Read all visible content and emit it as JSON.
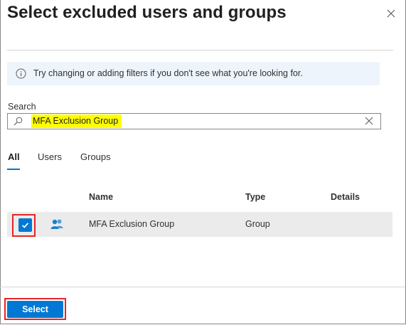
{
  "dialog": {
    "title": "Select excluded users and groups"
  },
  "info": {
    "message": "Try changing or adding filters if you don't see what you're looking for."
  },
  "search": {
    "label": "Search",
    "value": "MFA Exclusion Group"
  },
  "tabs": [
    {
      "label": "All",
      "active": true
    },
    {
      "label": "Users",
      "active": false
    },
    {
      "label": "Groups",
      "active": false
    }
  ],
  "table": {
    "columns": [
      "Name",
      "Type",
      "Details"
    ],
    "rows": [
      {
        "checked": true,
        "icon": "group-icon",
        "name": "MFA Exclusion Group",
        "type": "Group",
        "details": ""
      }
    ]
  },
  "footer": {
    "select_label": "Select"
  },
  "colors": {
    "accent": "#0078d4",
    "highlight_border": "#e52525",
    "search_highlight": "#ffff00",
    "info_background": "#eef4fb"
  }
}
